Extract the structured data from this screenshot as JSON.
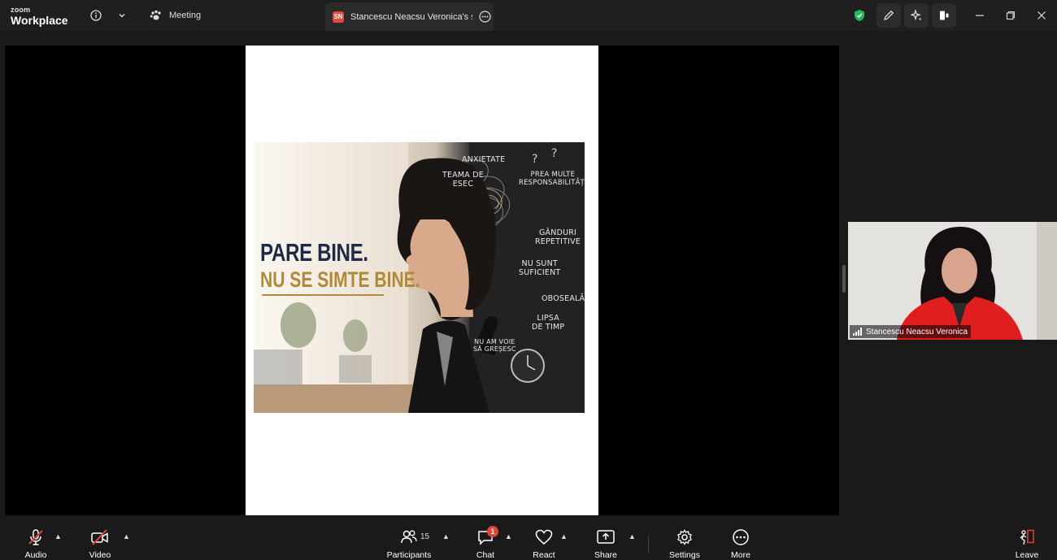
{
  "titlebar": {
    "logo_top": "zoom",
    "logo_bottom": "Workplace",
    "meeting_label": "Meeting",
    "share_tab_initials": "SN",
    "share_tab_label": "Stancescu Neacsu Veronica's screen"
  },
  "slide": {
    "headline_line1": "PARE BINE.",
    "headline_line2": "NU SE SIMTE BINE.",
    "words": {
      "anxietate": "ANXIETATE",
      "teama": "TEAMA DE\nESEC",
      "prea_multe": "PREA MULTE\nRESPONSABILITĂȚI",
      "ganduri": "GÂNDURI\nREPETITIVE",
      "nu_sunt": "NU SUNT\nSUFICIENT",
      "oboseala": "OBOSEALĂ",
      "lipsa": "LIPSA\nDE TIMP",
      "nu_am_voie": "NU AM VOIE\nSĂ GREȘESC"
    }
  },
  "participant": {
    "name": "Stancescu Neacsu Veronica"
  },
  "toolbar": {
    "audio": "Audio",
    "video": "Video",
    "participants": "Participants",
    "participants_count": "15",
    "chat": "Chat",
    "chat_badge": "1",
    "react": "React",
    "share": "Share",
    "settings": "Settings",
    "more": "More",
    "leave": "Leave"
  },
  "colors": {
    "background": "#1a1a1a",
    "stage": "#000000",
    "accent_red": "#e0453a",
    "shield_green": "#1fba5c",
    "headline_navy": "#1f2a44",
    "headline_gold": "#b08a35"
  }
}
